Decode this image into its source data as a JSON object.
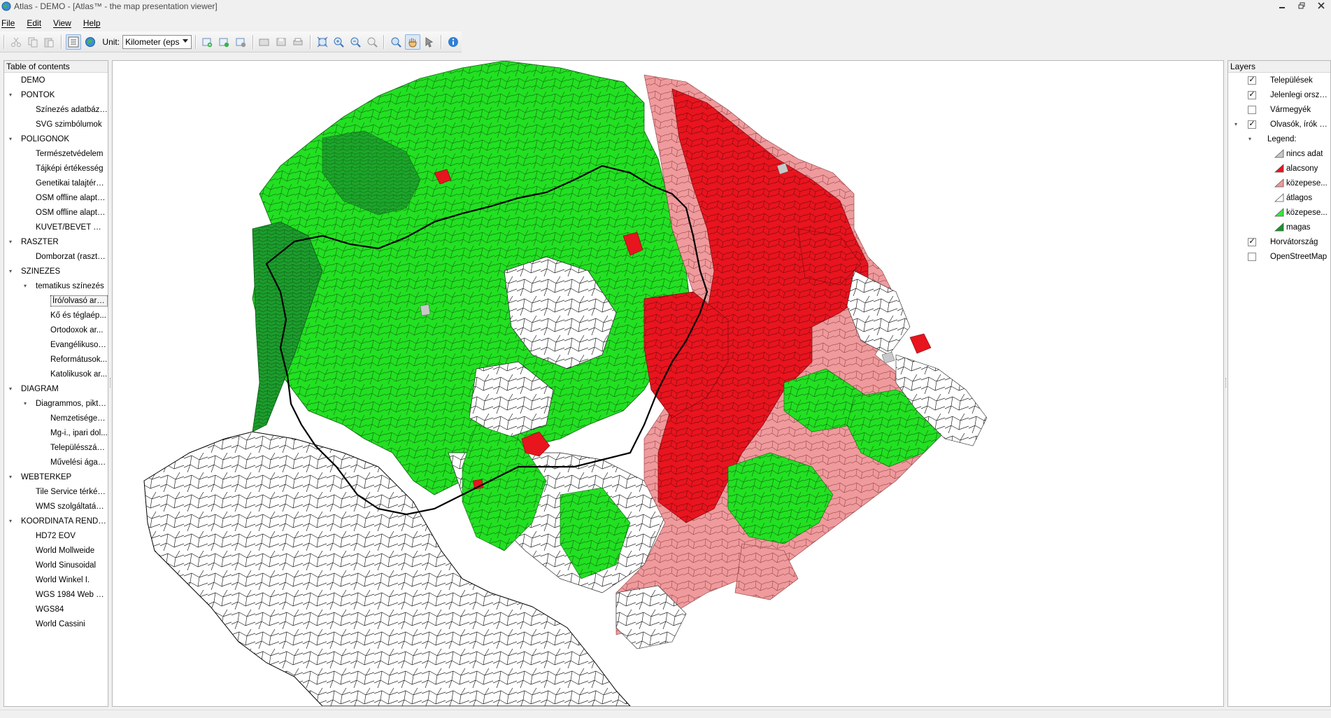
{
  "window": {
    "title": "Atlas - DEMO - [Atlas™ - the map presentation viewer]"
  },
  "menu": {
    "file": "File",
    "edit": "Edit",
    "view": "View",
    "help": "Help"
  },
  "toolbar": {
    "unit_label": "Unit:",
    "unit_value": "Kilometer (eps"
  },
  "toc": {
    "header": "Table of contents",
    "items": [
      {
        "label": "DEMO",
        "depth": 0,
        "expander": false
      },
      {
        "label": "PONTOK",
        "depth": 0,
        "expander": true
      },
      {
        "label": "Színezés adatbázis...",
        "depth": 1
      },
      {
        "label": "SVG szimbólumok",
        "depth": 1
      },
      {
        "label": "POLIGONOK",
        "depth": 0,
        "expander": true
      },
      {
        "label": "Természetvédelem",
        "depth": 1
      },
      {
        "label": "Tájképi értékesség",
        "depth": 1
      },
      {
        "label": "Genetikai talajtérkép",
        "depth": 1
      },
      {
        "label": "OSM offline alapté...",
        "depth": 1
      },
      {
        "label": "OSM offline alapté...",
        "depth": 1
      },
      {
        "label": "KÜVET/BEVET minta",
        "depth": 1
      },
      {
        "label": "RASZTER",
        "depth": 0,
        "expander": true
      },
      {
        "label": "Domborzat (raszte...",
        "depth": 1
      },
      {
        "label": "SZÍNEZÉS",
        "depth": 0,
        "expander": true
      },
      {
        "label": "tematikus színezés",
        "depth": 1,
        "expander": true
      },
      {
        "label": "Író/olvasó ará...",
        "depth": 2,
        "selected": true
      },
      {
        "label": "Kő és téglaép...",
        "depth": 2
      },
      {
        "label": "Ortodoxok ar...",
        "depth": 2
      },
      {
        "label": "Evangélikusok...",
        "depth": 2
      },
      {
        "label": "Reformátusok...",
        "depth": 2
      },
      {
        "label": "Katolikusok ar...",
        "depth": 2
      },
      {
        "label": "DIAGRAM",
        "depth": 0,
        "expander": true
      },
      {
        "label": "Diagrammos, pikto...",
        "depth": 1,
        "expander": true
      },
      {
        "label": "Nemzetiségek ...",
        "depth": 2
      },
      {
        "label": "Mg-i., ipari dol...",
        "depth": 2
      },
      {
        "label": "Településszám...",
        "depth": 2
      },
      {
        "label": "Művelési ágak...",
        "depth": 2
      },
      {
        "label": "WEBTÉRKÉP",
        "depth": 0,
        "expander": true
      },
      {
        "label": "Tile Service térképek",
        "depth": 1
      },
      {
        "label": "WMS szolgáltatások",
        "depth": 1
      },
      {
        "label": "KOORDINÁTA RENDSZ...",
        "depth": 0,
        "expander": true
      },
      {
        "label": "HD72 EOV",
        "depth": 1
      },
      {
        "label": "World Mollweide",
        "depth": 1
      },
      {
        "label": "World Sinusoidal",
        "depth": 1
      },
      {
        "label": "World Winkel I.",
        "depth": 1
      },
      {
        "label": "WGS 1984 Web M...",
        "depth": 1
      },
      {
        "label": "WGS84",
        "depth": 1
      },
      {
        "label": "World Cassini",
        "depth": 1
      }
    ]
  },
  "layers": {
    "header": "Layers",
    "items": [
      {
        "label": "Települések",
        "checked": true
      },
      {
        "label": "Jelenlegi orszá...",
        "checked": true
      },
      {
        "label": "Vármegyék",
        "checked": false
      },
      {
        "label": "Olvasók, írók a...",
        "checked": true,
        "expander": true
      }
    ],
    "legend_title": "Legend:",
    "legend": [
      {
        "label": "nincs adat",
        "color": "#c8c8c8"
      },
      {
        "label": "alacsony",
        "color": "#e8141e"
      },
      {
        "label": "közepese...",
        "color": "#f0999b"
      },
      {
        "label": "átlagos",
        "color": "#ffffff"
      },
      {
        "label": "közepese...",
        "color": "#38e838"
      },
      {
        "label": "magas",
        "color": "#149628"
      }
    ],
    "items_after": [
      {
        "label": "Horvátország",
        "checked": true
      },
      {
        "label": "OpenStreetMap",
        "checked": false
      }
    ]
  },
  "map": {
    "colors": {
      "green": "#22e022",
      "dark_green": "#1a9a2a",
      "red": "#e8141e",
      "pink": "#ef9a9c",
      "white": "#ffffff",
      "grey": "#c8c8c8"
    }
  }
}
